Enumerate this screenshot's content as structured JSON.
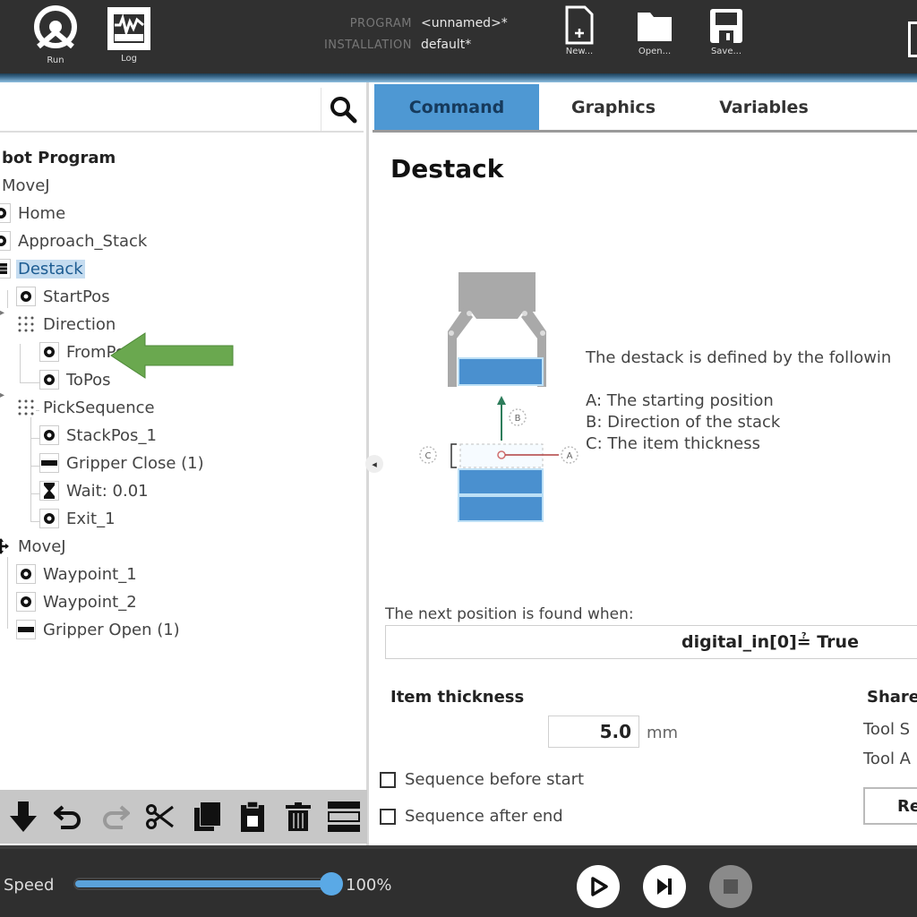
{
  "header": {
    "run_label": "Run",
    "log_label": "Log",
    "program_key": "PROGRAM",
    "program_value": "<unnamed>*",
    "installation_key": "INSTALLATION",
    "installation_value": "default*",
    "new_label": "New...",
    "open_label": "Open...",
    "save_label": "Save..."
  },
  "left_panel": {
    "search_placeholder": "",
    "tree": [
      {
        "label": "bot Program",
        "icon": "none",
        "root": true
      },
      {
        "label": "MoveJ",
        "icon": "none"
      },
      {
        "label": "Home",
        "icon": "waypoint-icon"
      },
      {
        "label": "Approach_Stack",
        "icon": "waypoint-icon"
      },
      {
        "label": "Destack",
        "icon": "destack-icon",
        "selected": true
      },
      {
        "label": "StartPos",
        "icon": "waypoint-icon"
      },
      {
        "label": "Direction",
        "icon": "grid-dots-icon"
      },
      {
        "label": "FromPos",
        "icon": "waypoint-icon"
      },
      {
        "label": "ToPos",
        "icon": "waypoint-icon"
      },
      {
        "label": "PickSequence",
        "icon": "grid-dots-icon"
      },
      {
        "label": "StackPos_1",
        "icon": "waypoint-icon"
      },
      {
        "label": "Gripper Close (1)",
        "icon": "gripper-icon"
      },
      {
        "label": "Wait: 0.01",
        "icon": "hourglass-icon"
      },
      {
        "label": "Exit_1",
        "icon": "waypoint-icon"
      },
      {
        "label": "MoveJ",
        "icon": "move-icon"
      },
      {
        "label": "Waypoint_1",
        "icon": "waypoint-icon"
      },
      {
        "label": "Waypoint_2",
        "icon": "waypoint-icon"
      },
      {
        "label": "Gripper Open (1)",
        "icon": "gripper-icon"
      }
    ],
    "toolbar": [
      "move-down",
      "undo",
      "redo",
      "cut",
      "copy",
      "paste",
      "delete",
      "suppress"
    ]
  },
  "right_panel": {
    "tabs": [
      {
        "label": "Command",
        "active": true
      },
      {
        "label": "Graphics",
        "active": false
      },
      {
        "label": "Variables",
        "active": false
      }
    ],
    "title": "Destack",
    "diagram_labels": {
      "a": "A",
      "b": "B",
      "c": "C"
    },
    "description_intro": "The destack is defined by the followin",
    "description_items": [
      "A: The starting position",
      "B: Direction of the stack",
      "C: The item thickness"
    ],
    "next_position_label": "The next position is found when:",
    "condition": "digital_in[0]≟ True",
    "item_thickness_label": "Item thickness",
    "item_thickness_value": "5.0",
    "item_thickness_unit": "mm",
    "sequence_before_start": "Sequence before start",
    "sequence_after_end": "Sequence after end",
    "shared_label": "Share",
    "tool_s_label": "Tool S",
    "tool_a_label": "Tool A",
    "reset_label": "Re",
    "colors": {
      "accent": "#4e98d3",
      "stack_blue": "#4a90cf",
      "arrow_green": "#6aa84f"
    }
  },
  "footer": {
    "speed_label": "Speed",
    "speed_value": "100%",
    "speed_fraction": 1.0
  }
}
